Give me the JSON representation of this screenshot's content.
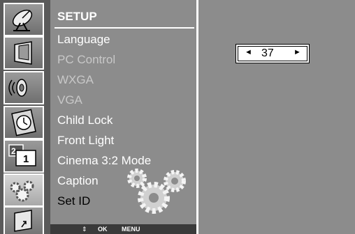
{
  "sidebar": {
    "icons": [
      {
        "name": "satellite-dish-icon"
      },
      {
        "name": "picture-icon"
      },
      {
        "name": "speaker-icon"
      },
      {
        "name": "clock-icon"
      },
      {
        "name": "pip-icon",
        "labels": [
          "2",
          "1"
        ]
      },
      {
        "name": "setup-gears-icon"
      },
      {
        "name": "input-icon"
      }
    ]
  },
  "menu": {
    "title": "SETUP",
    "items": [
      {
        "label": "Language",
        "state": "enabled"
      },
      {
        "label": "PC Control",
        "state": "disabled"
      },
      {
        "label": "WXGA",
        "state": "disabled"
      },
      {
        "label": "VGA",
        "state": "disabled"
      },
      {
        "label": "Child Lock",
        "state": "enabled"
      },
      {
        "label": "Front Light",
        "state": "enabled"
      },
      {
        "label": "Cinema 3:2 Mode",
        "state": "enabled"
      },
      {
        "label": "Caption",
        "state": "enabled"
      },
      {
        "label": "Set ID",
        "state": "selected"
      }
    ],
    "footer": {
      "nav_icon": "⇕",
      "ok_label": "OK",
      "menu_label": "MENU"
    }
  },
  "panel": {
    "value": "37",
    "left_arrow": "◄",
    "right_arrow": "►"
  },
  "colors": {
    "menu_bg": "#8c8c8c",
    "sidebar_bg": "#5a5a5a",
    "text": "#ffffff",
    "disabled_text": "#c8c8c8",
    "selected_text": "#000000"
  }
}
